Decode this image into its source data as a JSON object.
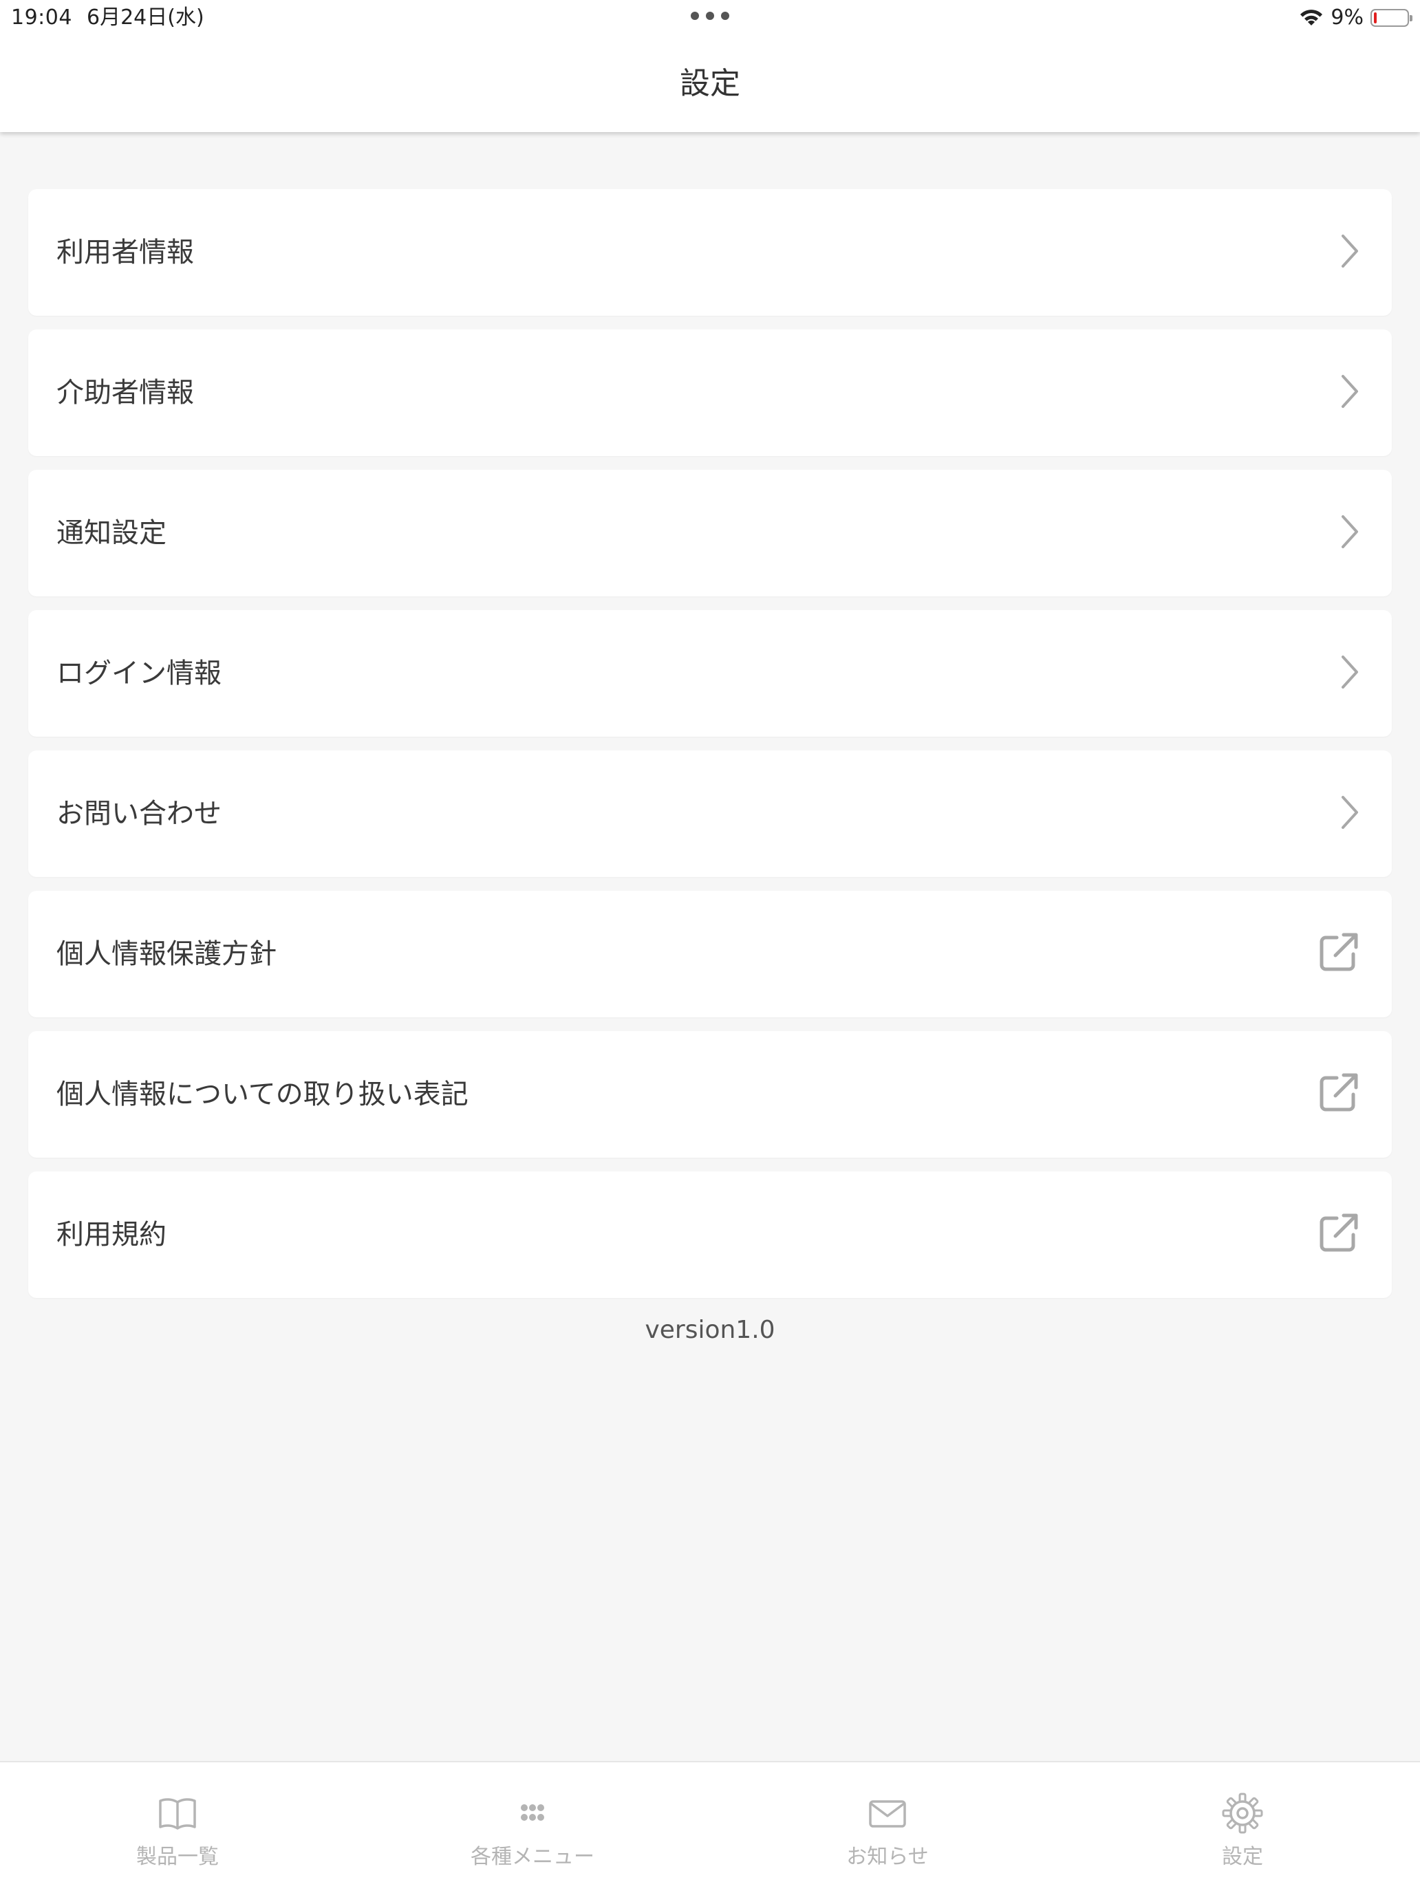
{
  "status_bar": {
    "time": "19:04",
    "date": "6月24日(水)",
    "battery_percent_label": "9%",
    "battery_level": 0.09,
    "battery_color": "#e02020"
  },
  "header": {
    "title": "設定"
  },
  "menu": {
    "items": [
      {
        "label": "利用者情報",
        "icon": "chevron-right-icon"
      },
      {
        "label": "介助者情報",
        "icon": "chevron-right-icon"
      },
      {
        "label": "通知設定",
        "icon": "chevron-right-icon"
      },
      {
        "label": "ログイン情報",
        "icon": "chevron-right-icon"
      },
      {
        "label": "お問い合わせ",
        "icon": "chevron-right-icon"
      },
      {
        "label": "個人情報保護方針",
        "icon": "external-link-icon"
      },
      {
        "label": "個人情報についての取り扱い表記",
        "icon": "external-link-icon"
      },
      {
        "label": "利用規約",
        "icon": "external-link-icon"
      }
    ]
  },
  "footer": {
    "version": "version1.0"
  },
  "tabbar": {
    "tabs": [
      {
        "label": "製品一覧",
        "icon": "book-icon"
      },
      {
        "label": "各種メニュー",
        "icon": "grid-dots-icon"
      },
      {
        "label": "お知らせ",
        "icon": "mail-icon"
      },
      {
        "label": "設定",
        "icon": "gear-icon"
      }
    ],
    "inactive_color": "#b4b4b4"
  }
}
